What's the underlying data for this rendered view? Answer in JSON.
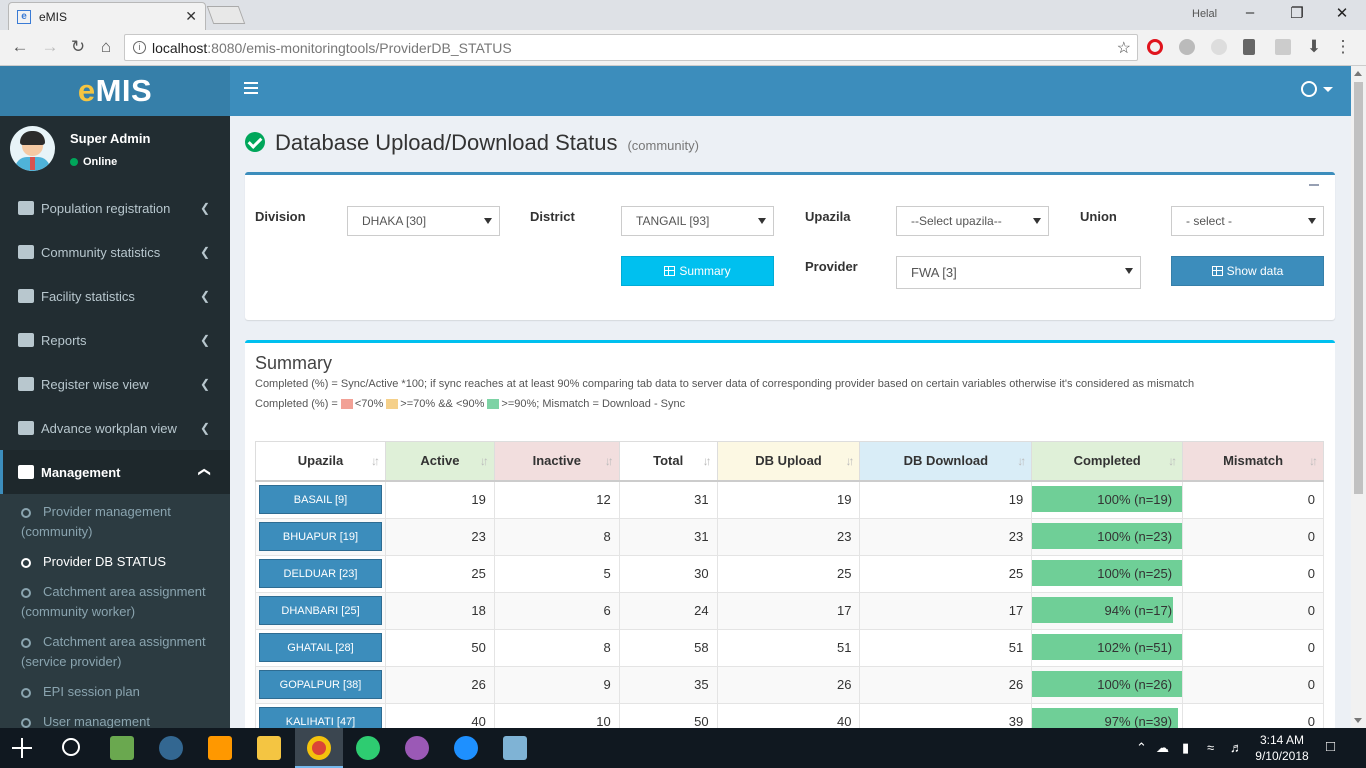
{
  "browser": {
    "tab_title": "eMIS",
    "tab_close": "✕",
    "user_label": "Helal",
    "url_host": "localhost",
    "url_path": ":8080/emis-monitoringtools/ProviderDB_STATUS"
  },
  "app": {
    "logo_e": "e",
    "logo_rest": "MIS"
  },
  "user": {
    "name": "Super Admin",
    "status": "Online"
  },
  "sidebar": {
    "items": [
      {
        "label": "Population registration",
        "icon": "users-icon"
      },
      {
        "label": "Community statistics",
        "icon": "home-icon"
      },
      {
        "label": "Facility statistics",
        "icon": "hospital-icon"
      },
      {
        "label": "Reports",
        "icon": "report-icon"
      },
      {
        "label": "Register wise view",
        "icon": "book-icon"
      },
      {
        "label": "Advance workplan view",
        "icon": "calendar-icon"
      },
      {
        "label": "Management",
        "icon": "wrench-icon"
      }
    ],
    "management_sub": [
      "Provider management (community)",
      "Provider DB STATUS",
      "Catchment area assignment (community worker)",
      "Catchment area assignment (service provider)",
      "EPI session plan",
      "User management"
    ]
  },
  "page": {
    "title": "Database Upload/Download Status",
    "subtitle": "(community)"
  },
  "filters": {
    "division_label": "Division",
    "division_value": "DHAKA [30]",
    "district_label": "District",
    "district_value": "TANGAIL [93]",
    "upazila_label": "Upazila",
    "upazila_value": "--Select upazila--",
    "union_label": "Union",
    "union_value": "- select -",
    "provider_label": "Provider",
    "provider_value": "FWA [3]",
    "summary_button": "Summary",
    "show_button": "Show data"
  },
  "summary": {
    "title": "Summary",
    "note": "Completed (%) = Sync/Active *100; if sync reaches at at least 90% comparing tab data to server data of corresponding provider based on certain variables otherwise it's considered as mismatch",
    "legend_prefix": "Completed (%) =",
    "legend_red": "<70%",
    "legend_yellow": ">=70% && <90%",
    "legend_green": ">=90%; Mismatch = Download - Sync",
    "colors": {
      "red": "#f2a196",
      "yellow": "#f5d08a",
      "green": "#7dd3a5"
    }
  },
  "table": {
    "headers": [
      "Upazila",
      "Active",
      "Inactive",
      "Total",
      "DB Upload",
      "DB Download",
      "Completed",
      "Mismatch"
    ],
    "header_colors": [
      "#ffffff",
      "#dff0d8",
      "#f2dede",
      "#ffffff",
      "#fcf8e3",
      "#d9edf7",
      "#dff0d8",
      "#f2dede"
    ],
    "rows": [
      {
        "upazila": "BASAIL [9]",
        "active": "19",
        "inactive": "12",
        "total": "31",
        "upload": "19",
        "download": "19",
        "completed": "100% (n=19)",
        "pct": 100,
        "mismatch": "0"
      },
      {
        "upazila": "BHUAPUR [19]",
        "active": "23",
        "inactive": "8",
        "total": "31",
        "upload": "23",
        "download": "23",
        "completed": "100% (n=23)",
        "pct": 100,
        "mismatch": "0"
      },
      {
        "upazila": "DELDUAR [23]",
        "active": "25",
        "inactive": "5",
        "total": "30",
        "upload": "25",
        "download": "25",
        "completed": "100% (n=25)",
        "pct": 100,
        "mismatch": "0"
      },
      {
        "upazila": "DHANBARI [25]",
        "active": "18",
        "inactive": "6",
        "total": "24",
        "upload": "17",
        "download": "17",
        "completed": "94% (n=17)",
        "pct": 94,
        "mismatch": "0"
      },
      {
        "upazila": "GHATAIL [28]",
        "active": "50",
        "inactive": "8",
        "total": "58",
        "upload": "51",
        "download": "51",
        "completed": "102% (n=51)",
        "pct": 102,
        "mismatch": "0"
      },
      {
        "upazila": "GOPALPUR [38]",
        "active": "26",
        "inactive": "9",
        "total": "35",
        "upload": "26",
        "download": "26",
        "completed": "100% (n=26)",
        "pct": 100,
        "mismatch": "0"
      },
      {
        "upazila": "KALIHATI [47]",
        "active": "40",
        "inactive": "10",
        "total": "50",
        "upload": "40",
        "download": "39",
        "completed": "97% (n=39)",
        "pct": 97,
        "mismatch": "0"
      }
    ]
  },
  "taskbar": {
    "time": "3:14 AM",
    "date": "9/10/2018"
  }
}
